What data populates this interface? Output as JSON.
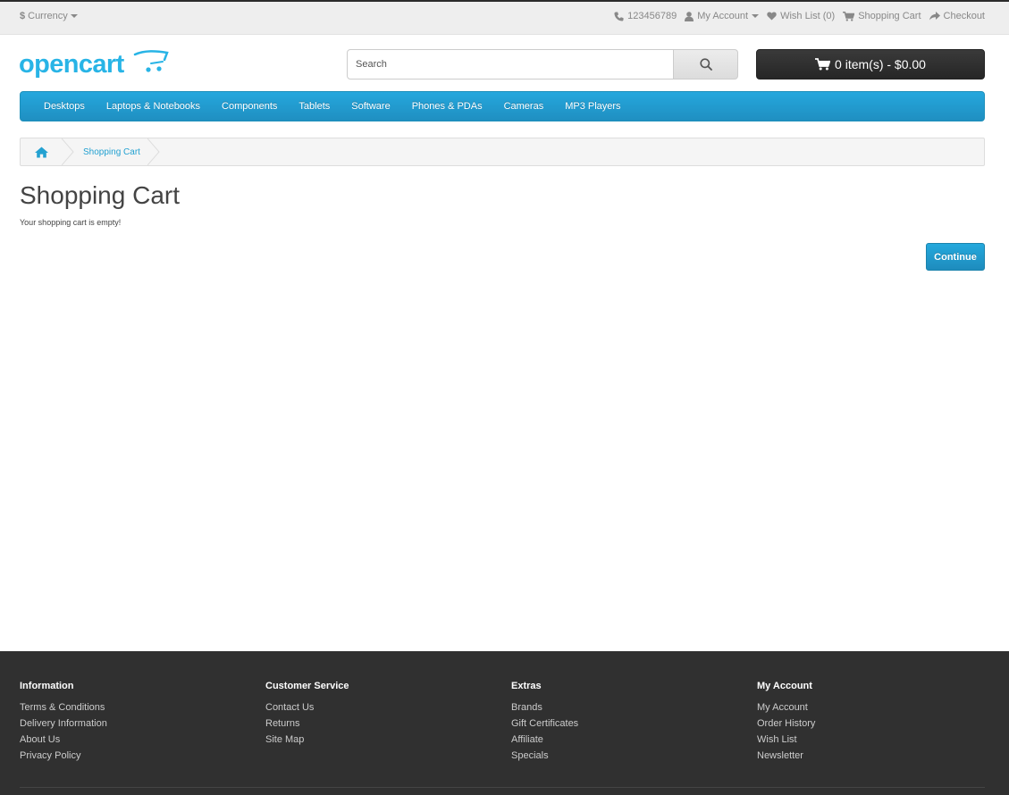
{
  "topbar": {
    "currency_symbol": "$",
    "currency_label": "Currency",
    "phone": "123456789",
    "my_account": "My Account",
    "wish_list": "Wish List (0)",
    "shopping_cart": "Shopping Cart",
    "checkout": "Checkout"
  },
  "header": {
    "logo_text": "opencart",
    "search_placeholder": "Search",
    "cart_summary": "0 item(s) - $0.00"
  },
  "menu": {
    "items": [
      "Desktops",
      "Laptops & Notebooks",
      "Components",
      "Tablets",
      "Software",
      "Phones & PDAs",
      "Cameras",
      "MP3 Players"
    ]
  },
  "breadcrumb": {
    "current": "Shopping Cart"
  },
  "main": {
    "title": "Shopping Cart",
    "empty_message": "Your shopping cart is empty!",
    "continue_label": "Continue"
  },
  "footer": {
    "information": {
      "heading": "Information",
      "links": [
        "Terms & Conditions",
        "Delivery Information",
        "About Us",
        "Privacy Policy"
      ]
    },
    "customer_service": {
      "heading": "Customer Service",
      "links": [
        "Contact Us",
        "Returns",
        "Site Map"
      ]
    },
    "extras": {
      "heading": "Extras",
      "links": [
        "Brands",
        "Gift Certificates",
        "Affiliate",
        "Specials"
      ]
    },
    "my_account": {
      "heading": "My Account",
      "links": [
        "My Account",
        "Order History",
        "Wish List",
        "Newsletter"
      ]
    }
  },
  "colors": {
    "brand_blue": "#229ac8",
    "footer_bg": "#303030",
    "cart_button": "#303030"
  }
}
